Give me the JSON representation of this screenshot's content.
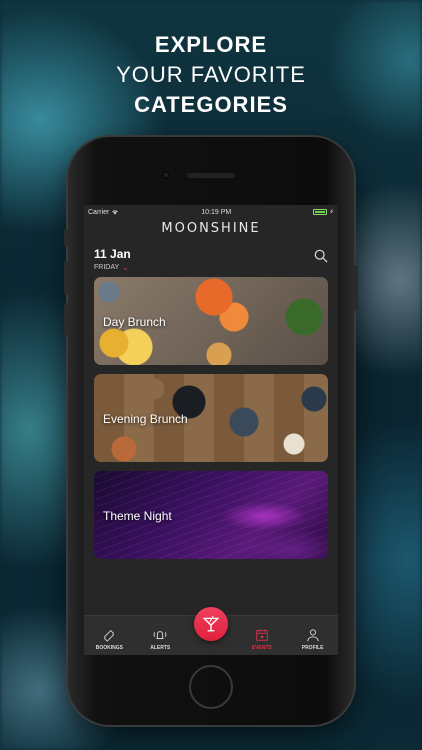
{
  "headline": {
    "line1": "EXPLORE",
    "line2": "YOUR FAVORITE",
    "line3": "CATEGORIES"
  },
  "statusbar": {
    "carrier": "Carrier",
    "time": "10:19 PM"
  },
  "app": {
    "brand": "MOONSHINE"
  },
  "datebar": {
    "date": "11 Jan",
    "weekday": "FRIDAY"
  },
  "categories": [
    {
      "label": "Day Brunch"
    },
    {
      "label": "Evening Brunch"
    },
    {
      "label": "Theme Night"
    }
  ],
  "tabs": {
    "bookings": "BOOKINGS",
    "alerts": "ALERTS",
    "events": "EVENTS",
    "profile": "PROFILE"
  },
  "colors": {
    "accent": "#e0304a",
    "screen_bg": "#262626",
    "tabbar_bg": "#2f2f2f"
  },
  "icons": {
    "search": "search-icon",
    "bookings": "ticket-icon",
    "alerts": "bell-icon",
    "center": "cocktail-icon",
    "events": "calendar-icon",
    "profile": "user-icon"
  }
}
